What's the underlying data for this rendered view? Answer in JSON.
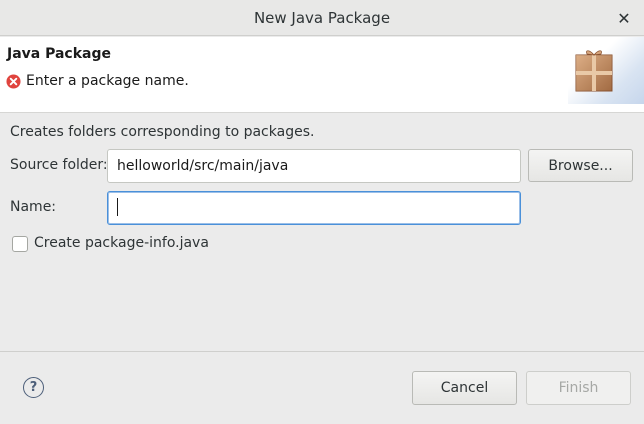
{
  "window": {
    "title": "New Java Package",
    "close_glyph": "✕"
  },
  "banner": {
    "heading": "Java Package",
    "message": "Enter a package name.",
    "message_icon": "error-icon",
    "image_icon": "package-icon"
  },
  "form": {
    "description": "Creates folders corresponding to packages.",
    "source_folder_label": "Source folder:",
    "source_folder_value": "helloworld/src/main/java",
    "browse_label": "Browse...",
    "name_label": "Name:",
    "name_value": "",
    "create_package_info_label": "Create package-info.java",
    "create_package_info_checked": false
  },
  "footer": {
    "help_glyph": "?",
    "cancel_label": "Cancel",
    "finish_label": "Finish",
    "finish_enabled": false
  },
  "colors": {
    "error_red": "#e0443e",
    "focus_blue": "#4a90d9",
    "package_brown": "#b9764a"
  }
}
